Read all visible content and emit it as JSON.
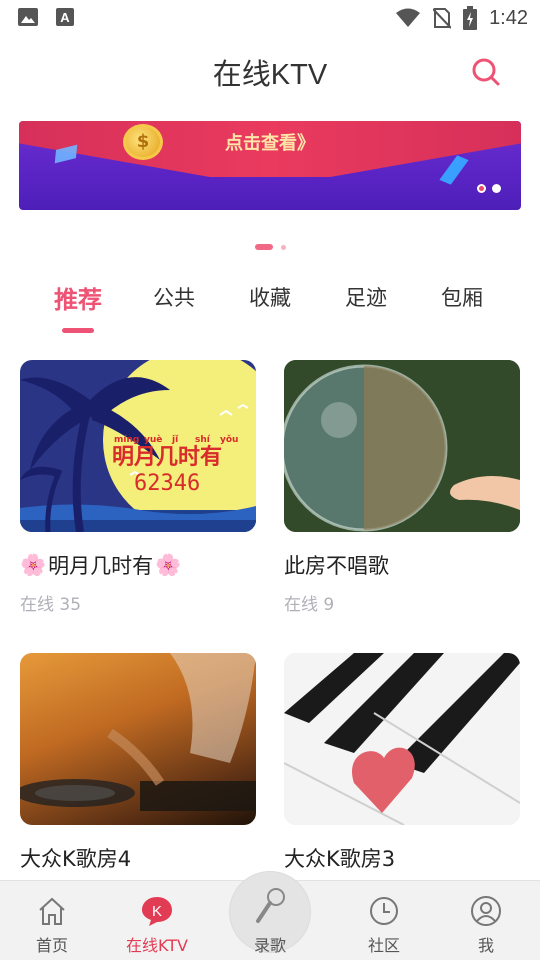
{
  "status_bar": {
    "time": "1:42"
  },
  "header": {
    "title": "在线KTV"
  },
  "banner": {
    "cta": "点击查看》",
    "coin_symbol": "$"
  },
  "tabs": [
    {
      "label": "推荐"
    },
    {
      "label": "公共"
    },
    {
      "label": "收藏"
    },
    {
      "label": "足迹"
    },
    {
      "label": "包厢"
    }
  ],
  "thumb1_art": {
    "pinyin": [
      "míng",
      "yuè",
      "jǐ",
      "shí",
      "yǒu"
    ],
    "hanzi": "明月几时有",
    "number": "62346"
  },
  "rooms": [
    {
      "name": "明月几时有",
      "online": "在线 35",
      "flower_prefix": "🌸",
      "flower_suffix": "🌸"
    },
    {
      "name": "此房不唱歌",
      "online": "在线 9"
    },
    {
      "name": "大众K歌房4",
      "online": ""
    },
    {
      "name": "大众K歌房3",
      "online": ""
    }
  ],
  "bottom_nav": [
    {
      "label": "首页",
      "icon": "home-icon"
    },
    {
      "label": "在线KTV",
      "icon": "ktv-bubble-icon",
      "badge": "K"
    },
    {
      "label": "录歌",
      "icon": "microphone-icon"
    },
    {
      "label": "社区",
      "icon": "clock-icon"
    },
    {
      "label": "我",
      "icon": "user-icon"
    }
  ],
  "colors": {
    "accent": "#ee5274",
    "nav_active": "#e23c54",
    "muted": "#b0b0b8"
  }
}
